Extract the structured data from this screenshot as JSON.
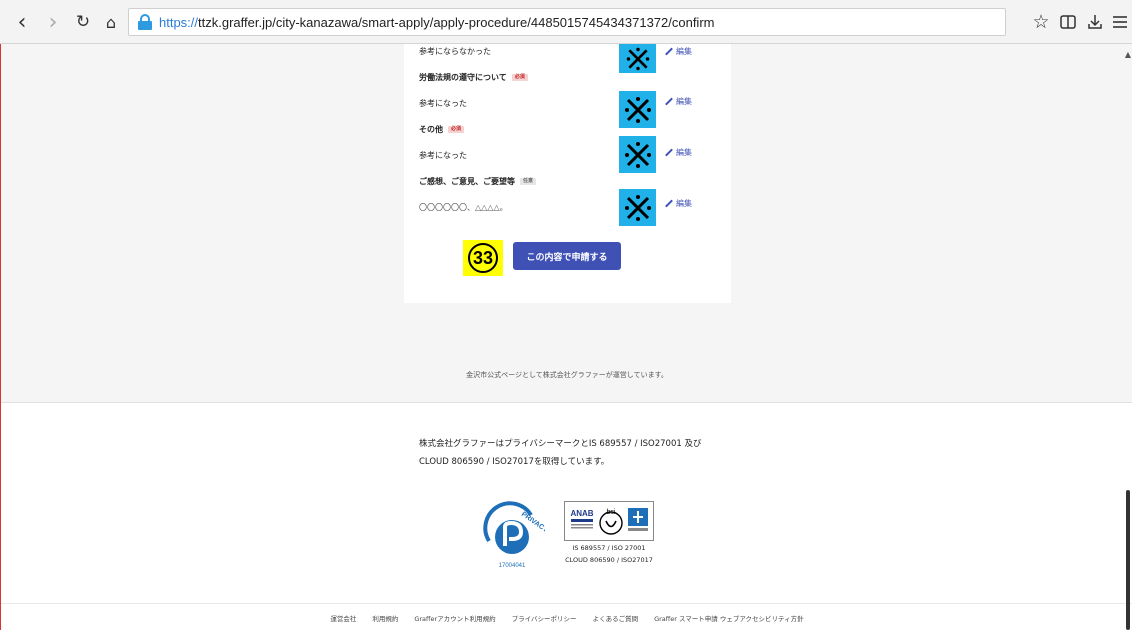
{
  "browser": {
    "url_scheme": "https://",
    "url_rest": "ttzk.graffer.jp/city-kanazawa/smart-apply/apply-procedure/4485015745434371372/confirm"
  },
  "form_rows": [
    {
      "text": "参考にならなかった",
      "kind": "value"
    },
    {
      "text": "労働法規の遵守について",
      "kind": "label",
      "badge": "必須"
    },
    {
      "text": "参考になった",
      "kind": "value"
    },
    {
      "text": "その他",
      "kind": "label",
      "badge": "必須"
    },
    {
      "text": "参考になった",
      "kind": "value"
    },
    {
      "text": "ご感想、ご意見、ご要望等",
      "kind": "label",
      "badge": "任意"
    },
    {
      "text": "〇〇〇〇〇〇、△△△△。",
      "kind": "muted"
    }
  ],
  "edit_label": "編集",
  "step_number": "33",
  "submit_label": "この内容で申請する",
  "operated_note": "金沢市公式ページとして株式会社グラファーが運営しています。",
  "footer": {
    "cert_line1": "株式会社グラファーはプライバシーマークとIS 689557 / ISO27001 及び",
    "cert_line2": "CLOUD 806590 / ISO27017を取得しています。",
    "privacy_mark_text": "PRIVACY",
    "privacy_mark_number": "17004041",
    "iso_anab": "ANAB",
    "iso_bsi": "bsi",
    "iso_caption1": "IS 689557 / ISO 27001",
    "iso_caption2": "CLOUD 806590 / ISO27017",
    "links": [
      "運営会社",
      "利用規約",
      "Grafferアカウント利用規約",
      "プライバシーポリシー",
      "よくあるご質問",
      "Graffer スマート申請 ウェブアクセシビリティ方針"
    ]
  },
  "colors": {
    "accent": "#3f51b5",
    "x_box": "#1fb1e8",
    "step_highlight": "#ffff00"
  }
}
